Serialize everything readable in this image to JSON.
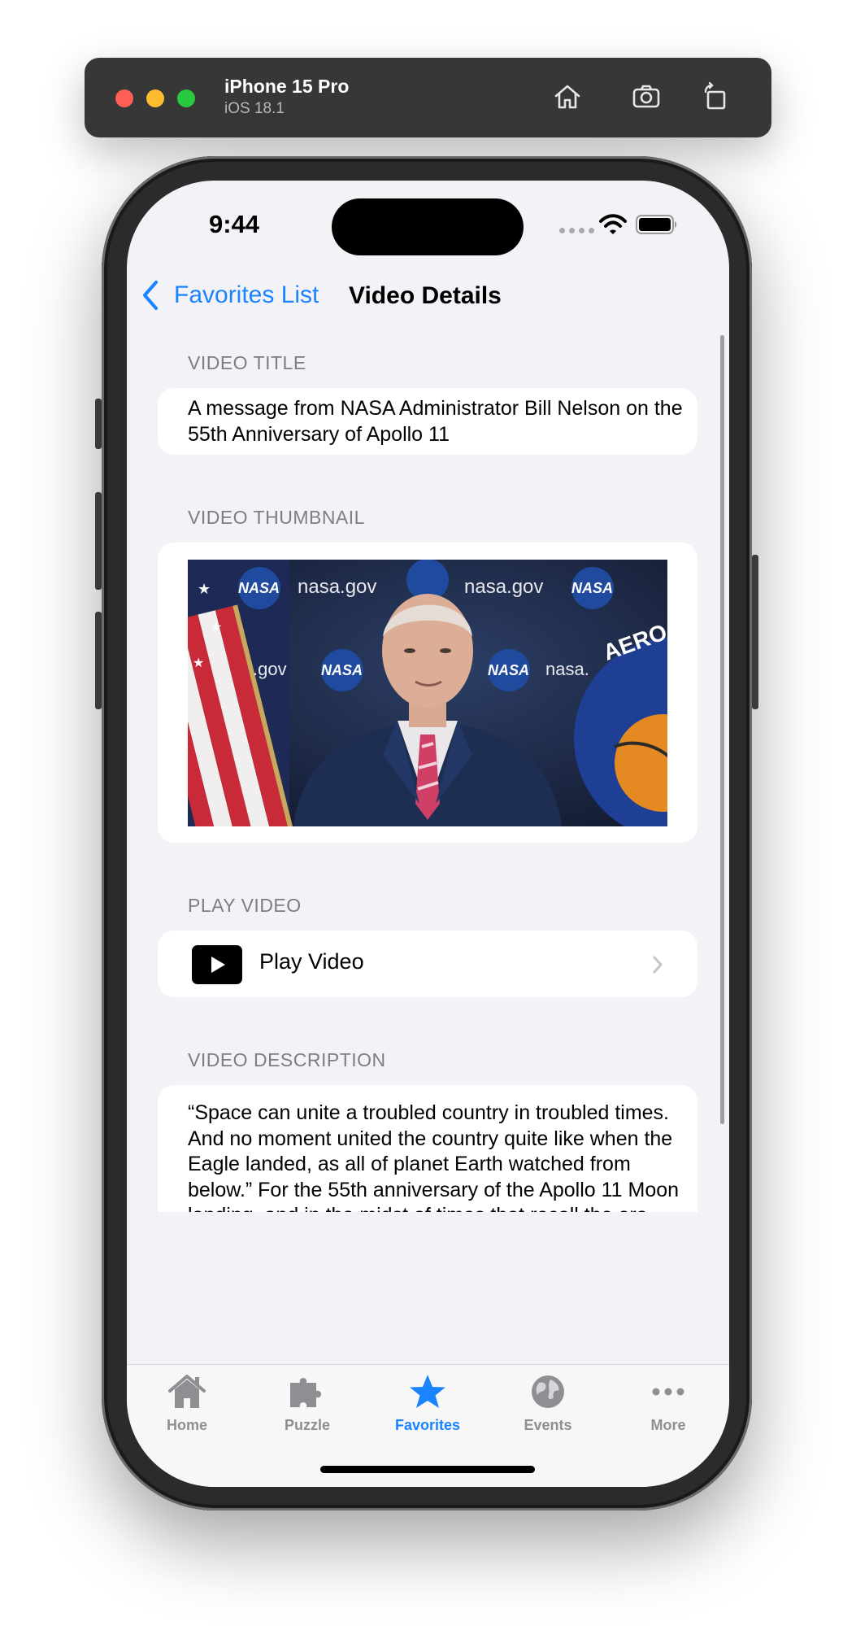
{
  "simulator": {
    "device_name": "iPhone 15 Pro",
    "os_version": "iOS 18.1",
    "icons": [
      "home-icon",
      "screenshot-icon",
      "rotate-icon"
    ]
  },
  "status_bar": {
    "time": "9:44",
    "icons": [
      "wifi-icon",
      "battery-icon"
    ]
  },
  "nav": {
    "back_label": "Favorites List",
    "title": "Video Details",
    "tint": "#1a84ff"
  },
  "sections": {
    "title_header": "VIDEO TITLE",
    "title_value": "A message from NASA Administrator Bill Nelson on the 55th Anniversary of Apollo 11",
    "thumbnail_header": "VIDEO THUMBNAIL",
    "play_header": "PLAY VIDEO",
    "play_label": "Play Video",
    "description_header": "VIDEO DESCRIPTION",
    "description_value": "“Space can unite a troubled country in troubled times. And no moment united the country quite like when the Eagle landed, as all of planet Earth watched from below.”    For the 55th anniversary of the Apollo 11 Moon landing, and in the midst of times that recall the era when the Moon landing took place, NASA Administrator Bill Nelson shares a message on the special power of space to bring people together—and the hope that this anniversary will be a time for"
  },
  "thumbnail": {
    "backdrop_text": [
      "nasa.gov",
      "nasa.gov",
      "NASA",
      "NASA",
      "NASA",
      "NASA",
      "NASA",
      ".gov",
      "nasa.",
      "AERO"
    ]
  },
  "tabs": [
    {
      "label": "Home",
      "icon": "house-icon"
    },
    {
      "label": "Puzzle",
      "icon": "puzzle-piece-icon"
    },
    {
      "label": "Favorites",
      "icon": "star-icon",
      "active": true
    },
    {
      "label": "Events",
      "icon": "globe-icon"
    },
    {
      "label": "More",
      "icon": "ellipsis-icon"
    }
  ],
  "colors": {
    "accent": "#1a84ff",
    "background": "#f2f2f7",
    "card": "#ffffff",
    "secondary_text": "#7d7d82"
  }
}
